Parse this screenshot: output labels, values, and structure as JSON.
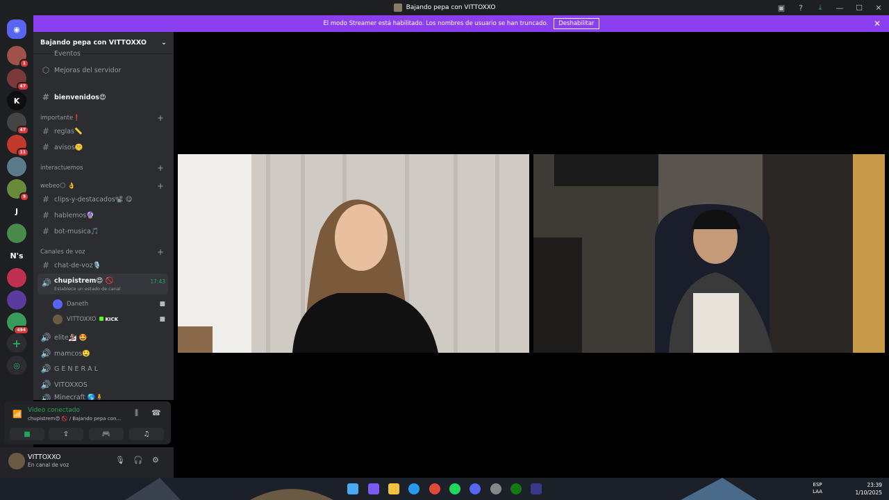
{
  "window": {
    "title": "Bajando pepa con VITTOXXO"
  },
  "banner": {
    "text": "El modo Streamer está habilitado. Los nombres de usuario se han truncado.",
    "button": "Deshabilitar"
  },
  "guilds": [
    {
      "badge": "1",
      "color": "#a0524a"
    },
    {
      "badge": "47",
      "color": "#7a3a3a"
    },
    {
      "label": "K",
      "color": "#0e0e10"
    },
    {
      "badge": "47",
      "color": "#444"
    },
    {
      "badge": "11",
      "color": "#c0392b"
    },
    {
      "badge": "",
      "color": "#5a7a8a"
    },
    {
      "badge": "9",
      "color": "#6a8a3a"
    },
    {
      "label": "J",
      "color": "#1e1f22"
    },
    {
      "badge": "",
      "color": "#4a8a4a"
    },
    {
      "label": "N's",
      "color": "#1e1f22"
    },
    {
      "badge": "",
      "color": "#c03050"
    },
    {
      "badge": "",
      "color": "#5a3a9a"
    },
    {
      "badge": "494",
      "color": "#3a9a5a"
    }
  ],
  "server": {
    "name": "Bajando pepa con VITTOXXO"
  },
  "sidebar": {
    "eventos": "Eventos",
    "mejoras": "Mejoras del servidor",
    "bienvenidos": "bienvenidos😍",
    "cat_importante": "importante❗",
    "reglas": "reglas📏",
    "avisos": "avisos🤫",
    "cat_interactuemos": "interactuemos",
    "cat_webeo": "webeo🌕 👌",
    "clips": "clips-y-destacados📽️ 😋",
    "hablemos": "hablemos🔮",
    "bot_musica": "bot-musica🎵",
    "cat_voz": "Canales de voz",
    "chat_voz": "chat-de-voz🎙️",
    "voice_channel": "chupistrem😍 🚫",
    "voice_status": "Establece un estado de canal",
    "voice_time": "17:43",
    "members": [
      {
        "name": "Daneth",
        "kick": ""
      },
      {
        "name": "VITTOXXO",
        "kick": "KICK"
      }
    ],
    "elite": "elite🏂 🤩",
    "mamcos": "mamcos🤤",
    "general": "G E N E R A L",
    "vitoxxos": "VITOXXOS",
    "minecraft": "Minecraft 🌎🧍"
  },
  "voice_panel": {
    "status": "Video conectado",
    "channel": "chupistrem😍 🚫 / Bajando pepa con..."
  },
  "user": {
    "name": "VITTOXXO",
    "status": "En canal de voz"
  },
  "taskbar": {
    "lang1": "ESP",
    "lang2": "LAA",
    "time": "23:39",
    "date": "1/10/2025"
  }
}
